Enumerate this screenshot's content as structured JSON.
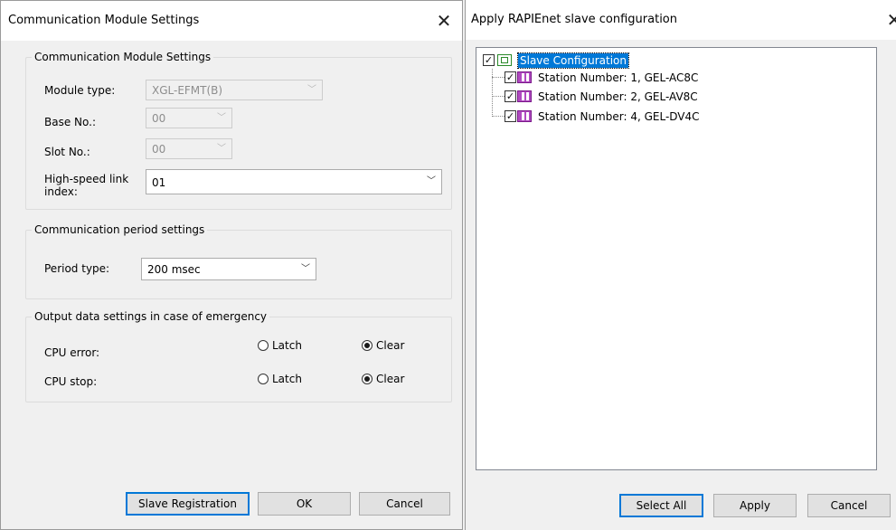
{
  "left_dialog": {
    "title": "Communication Module Settings",
    "close": "✕",
    "group_module": {
      "legend": "Communication Module Settings",
      "module_type_label": "Module type:",
      "module_type_value": "XGL-EFMT(B)",
      "base_no_label": "Base No.:",
      "base_no_value": "00",
      "slot_no_label": "Slot No.:",
      "slot_no_value": "00",
      "hs_link_label_line1": "High-speed link",
      "hs_link_label_line2": "index:",
      "hs_link_value": "01"
    },
    "group_period": {
      "legend": "Communication period settings",
      "period_type_label": "Period type:",
      "period_type_value": "200 msec"
    },
    "group_emergency": {
      "legend": "Output data settings in case of emergency",
      "cpu_error_label": "CPU error:",
      "cpu_stop_label": "CPU stop:",
      "latch_label": "Latch",
      "clear_label": "Clear",
      "cpu_error_selected": "Clear",
      "cpu_stop_selected": "Clear"
    },
    "buttons": {
      "slave_registration": "Slave Registration",
      "ok": "OK",
      "cancel": "Cancel"
    }
  },
  "right_dialog": {
    "title": "Apply RAPIEnet slave configuration",
    "close": "✕",
    "tree": {
      "root_label": "Slave Configuration",
      "root_checked": true,
      "stations": [
        {
          "label": "Station Number: 1, GEL-AC8C",
          "checked": true
        },
        {
          "label": "Station Number: 2, GEL-AV8C",
          "checked": true
        },
        {
          "label": "Station Number: 4, GEL-DV4C",
          "checked": true
        }
      ]
    },
    "buttons": {
      "select_all": "Select All",
      "apply": "Apply",
      "cancel": "Cancel"
    }
  },
  "icons": {
    "check": "✓",
    "dropdown": "﹀",
    "root_icon": "module-config-icon",
    "station_icon": "station-module-icon"
  },
  "colors": {
    "selection": "#0078d7",
    "default_button_border": "#0078d7",
    "station_icon": "#b04ac0",
    "root_icon": "#2a8a2a"
  }
}
